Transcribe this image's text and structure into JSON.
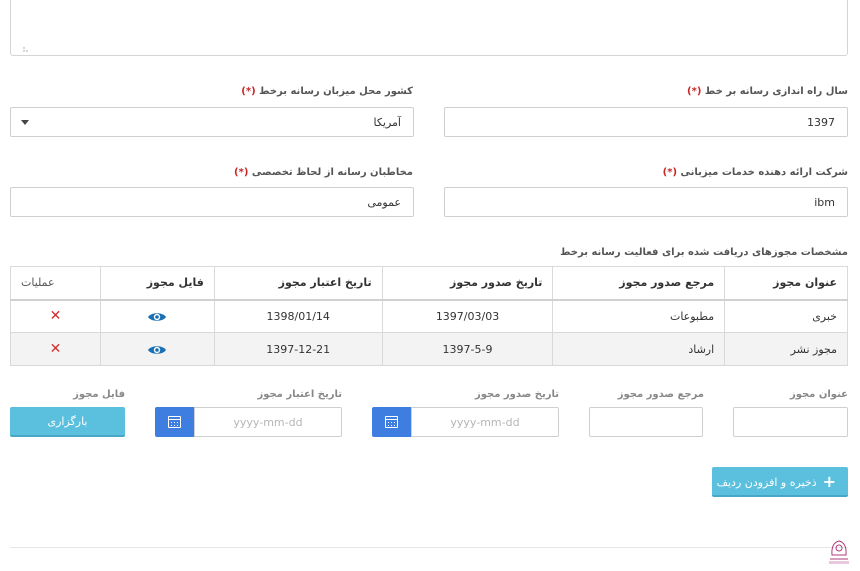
{
  "top": {
    "launch_year_label": "سال راه اندازی رسانه بر خط",
    "launch_year_value": "1397",
    "host_country_label": "کشور محل میزبان رسانه برخط",
    "host_country_value": "آمریکا",
    "hosting_company_label": "شرکت ارائه دهنده خدمات میزبانی",
    "hosting_company_value": "ibm",
    "audience_label": "مخاطبان رسانه از لحاظ تخصصی",
    "audience_value": "عمومی",
    "required_mark": "(*)"
  },
  "permits": {
    "section_title": "مشخصات مجوزهای دریافت شده برای فعالیت رسانه برخط",
    "headers": {
      "title": "عنوان مجوز",
      "issuer": "مرجع صدور مجوز",
      "issue_date": "تاریخ صدور مجوز",
      "expiry_date": "تاریخ اعتبار مجوز",
      "file": "فایل مجوز",
      "ops": "عملیات"
    },
    "rows": [
      {
        "title": "خبری",
        "issuer": "مطبوعات",
        "issue_date": "1397/03/03",
        "expiry_date": "1398/01/14"
      },
      {
        "title": "مجوز نشر",
        "issuer": "ارشاد",
        "issue_date": "1397-5-9",
        "expiry_date": "1397-12-21"
      }
    ],
    "delete_glyph": "✕",
    "eye_icon": "eye-icon"
  },
  "form": {
    "title_label": "عنوان مجوز",
    "issuer_label": "مرجع صدور مجوز",
    "issue_date_label": "تاریخ صدور مجوز",
    "expiry_date_label": "تاریخ اعتبار مجوز",
    "file_label": "فایل مجوز",
    "date_placeholder": "yyyy-mm-dd",
    "upload_label": "بارگزاری",
    "save_label": "ذخیره و افزودن ردیف",
    "save_icon": "plus-icon",
    "calendar_icon": "calendar-icon"
  },
  "colors": {
    "accent_blue": "#3d7ee0",
    "button_cyan": "#5bc0de",
    "required_red": "#c62828",
    "eye_blue": "#1a6fb5"
  }
}
